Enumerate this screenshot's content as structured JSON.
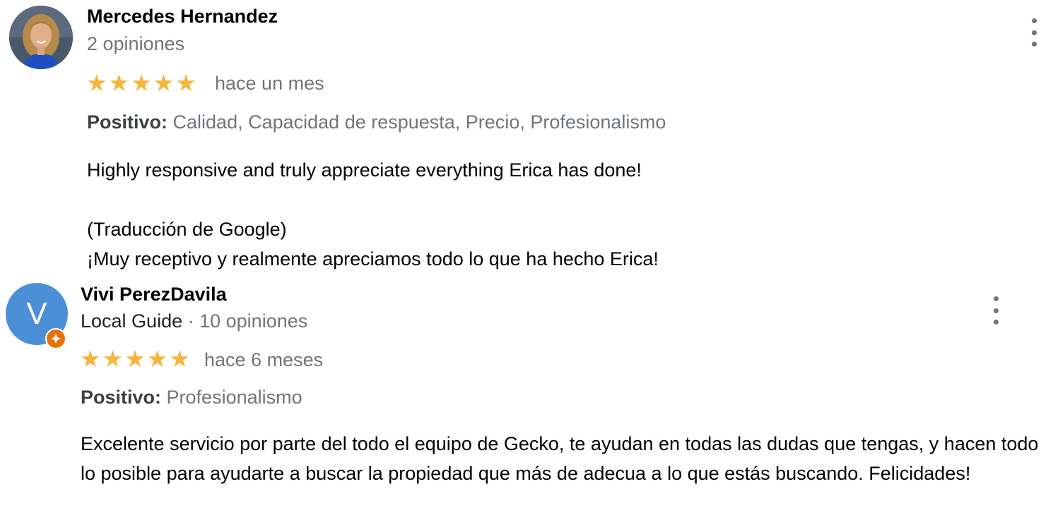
{
  "reviews": [
    {
      "author": "Mercedes Hernandez",
      "meta": "2 opiniones",
      "rating_stars": 5,
      "time": "hace un mes",
      "positive_label": "Positivo:",
      "positive_values": "Calidad, Capacidad de respuesta, Precio, Profesionalismo",
      "text_original": "Highly responsive and truly appreciate everything Erica has done!",
      "translation_label": "(Traducción de Google)",
      "text_translated": "¡Muy receptivo y realmente apreciamos todo lo que ha hecho Erica!",
      "avatar_icon": "photo-avatar"
    },
    {
      "author": "Vivi PerezDavila",
      "guide_label": "Local Guide",
      "meta_separator": " · ",
      "meta": "10 opiniones",
      "rating_stars": 5,
      "time": "hace 6 meses",
      "positive_label": "Positivo:",
      "positive_values": "Profesionalismo",
      "text_original": "Excelente servicio por parte del todo el equipo de Gecko, te ayudan en todas las dudas que tengas, y hacen todo lo posible para ayudarte a buscar la propiedad que más de adecua a lo que estás buscando. Felicidades!",
      "avatar_letter": "V",
      "avatar_color": "#4b8fd6",
      "badge_icon": "local-guide-badge-icon",
      "badge_color": "#e8710a"
    }
  ],
  "star_glyph": "★",
  "star_color": "#f4b63f",
  "menu_icon": "more-vert-icon"
}
